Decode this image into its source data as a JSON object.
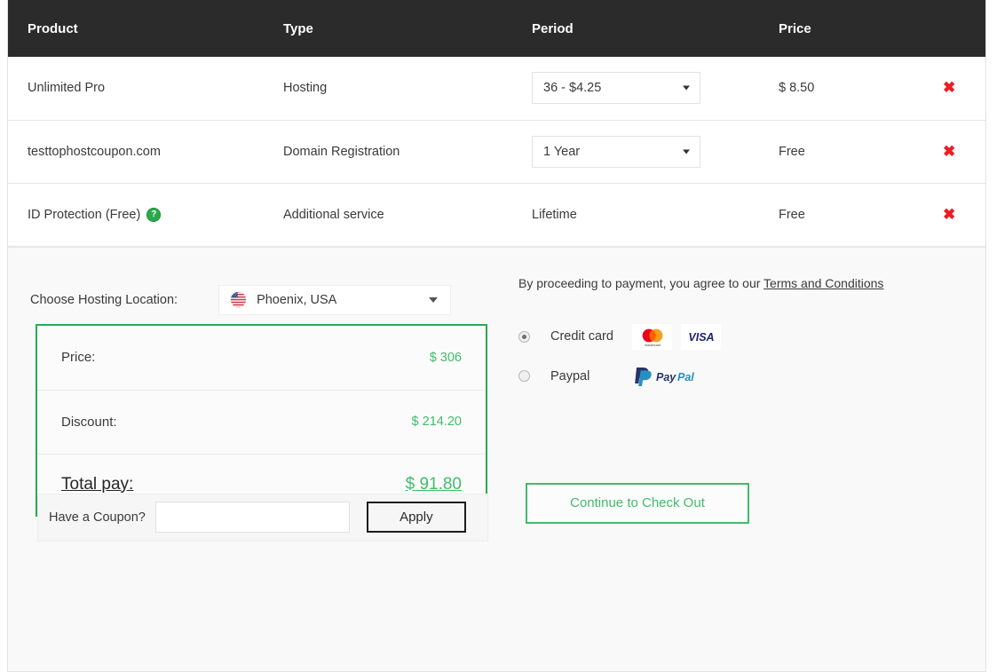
{
  "table": {
    "columns": [
      "Product",
      "Type",
      "Period",
      "Price",
      ""
    ],
    "rows": [
      {
        "product": "Unlimited Pro",
        "has_help_icon": false,
        "help_icon": "question-mark-icon",
        "type": "Hosting",
        "period": "36 - $4.25",
        "period_is_select": true,
        "price": "$ 8.50",
        "remove": "✖"
      },
      {
        "product": "testtophostcoupon.com",
        "has_help_icon": false,
        "help_icon": "question-mark-icon",
        "type": "Domain Registration",
        "period": "1 Year",
        "period_is_select": true,
        "price": "Free",
        "remove": "✖"
      },
      {
        "product": "ID Protection (Free)",
        "has_help_icon": true,
        "help_icon": "question-mark-icon",
        "type": "Additional service",
        "period": "Lifetime",
        "period_is_select": false,
        "price": "Free",
        "remove": "✖"
      }
    ]
  },
  "location": {
    "label": "Choose Hosting Location:",
    "selected": "Phoenix, USA",
    "flag_icon": "us-flag-icon",
    "caret_icon": "chevron-down-icon"
  },
  "summary": {
    "price_label": "Price:",
    "price_value": "$ 306",
    "discount_label": "Discount:",
    "discount_value": "$ 214.20",
    "total_label": "Total pay:",
    "total_value": "$ 91.80",
    "border_color": "#2aaa55",
    "value_color": "#3fbc6a"
  },
  "coupon": {
    "label": "Have a Coupon?",
    "value": "",
    "placeholder": "",
    "apply_label": "Apply"
  },
  "payment": {
    "terms_prefix": "By proceeding to payment, you agree to our ",
    "terms_link": "Terms and Conditions",
    "options": [
      {
        "label": "Credit card",
        "selected": true,
        "logos": [
          "mastercard-logo",
          "visa-logo"
        ]
      },
      {
        "label": "Paypal",
        "selected": false,
        "logos": [
          "paypal-logo"
        ]
      }
    ],
    "checkout_label": "Continue to Check Out",
    "checkout_color": "#3fbc6a"
  }
}
